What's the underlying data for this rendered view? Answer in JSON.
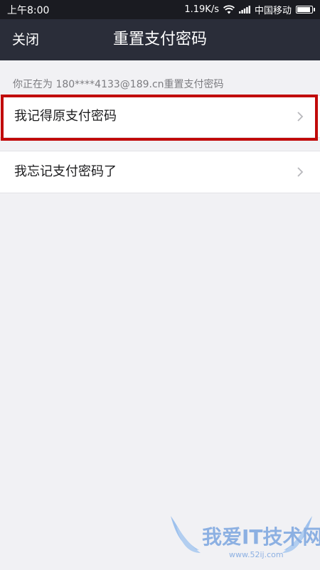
{
  "status_bar": {
    "time": "上午8:00",
    "network_speed": "1.19K/s",
    "carrier": "中国移动",
    "battery_level": 1.0,
    "icons": [
      "wifi-icon",
      "signal-icon",
      "battery-icon"
    ]
  },
  "nav": {
    "close_label": "关闭",
    "title": "重置支付密码"
  },
  "info_text": "你正在为 180****4133@189.cn重置支付密码",
  "options": [
    {
      "label": "我记得原支付密码",
      "icon": "chevron-right-icon",
      "highlighted": true
    },
    {
      "label": "我忘记支付密码了",
      "icon": "chevron-right-icon",
      "highlighted": false
    }
  ],
  "watermark": {
    "text": "我爱IT技术网",
    "url": "www.52ij.com"
  },
  "colors": {
    "status_bar_bg": "#1a1b21",
    "nav_bg": "#2a2d39",
    "page_bg": "#f1f1f4",
    "highlight_border": "#c10a0a"
  }
}
